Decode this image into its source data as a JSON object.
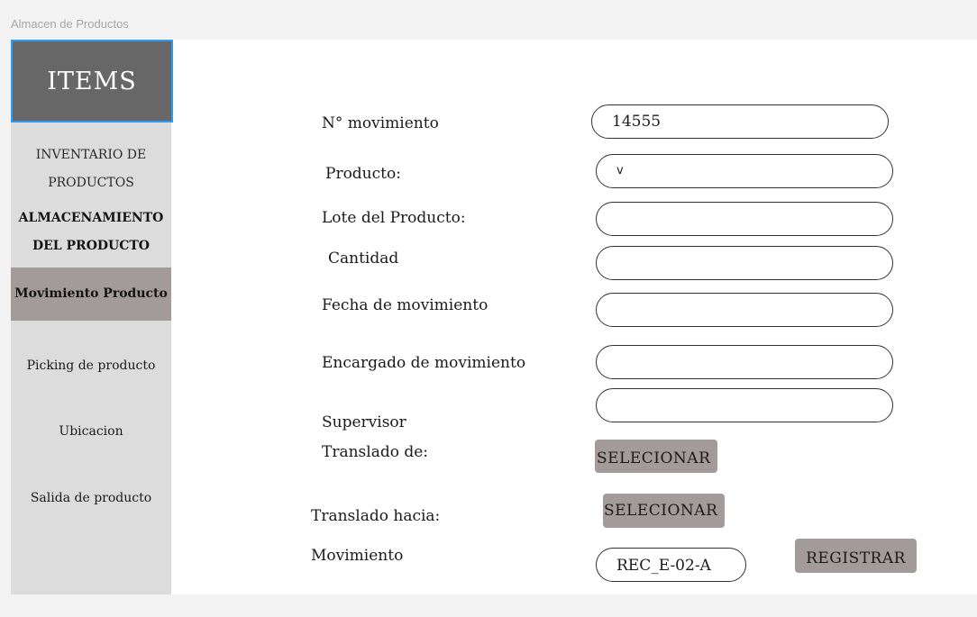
{
  "window": {
    "title": "Almacen de Productos"
  },
  "sidebar": {
    "header": "ITEMS",
    "items": [
      {
        "label_line1": "INVENTARIO DE",
        "label_line2": "PRODUCTOS"
      },
      {
        "label_line1": "ALMACENAMIENTO",
        "label_line2": "DEL PRODUCTO"
      },
      {
        "label": "Movimiento Producto",
        "active": true
      },
      {
        "label": "Picking de producto"
      },
      {
        "label": "Ubicacion"
      },
      {
        "label": "Salida de producto"
      }
    ]
  },
  "form": {
    "num_movimiento": {
      "label": "N° movimiento",
      "value": "14555"
    },
    "producto": {
      "label": "Producto:",
      "value": "v"
    },
    "lote": {
      "label": "Lote del Producto:",
      "value": ""
    },
    "cantidad": {
      "label": "Cantidad",
      "value": ""
    },
    "fecha": {
      "label": "Fecha de movimiento",
      "value": ""
    },
    "encargado": {
      "label": "Encargado de movimiento",
      "value": ""
    },
    "supervisor": {
      "label": "Supervisor",
      "value": ""
    },
    "translado_de": {
      "label": "Translado de:",
      "button": "SELECIONAR"
    },
    "translado_hacia": {
      "label": "Translado hacia:",
      "button": "SELECIONAR"
    },
    "movimiento": {
      "label": "Movimiento",
      "value": "REC_E-02-A"
    },
    "registrar_button": "REGISTRAR"
  },
  "colors": {
    "sidebar_bg": "#dcdcdc",
    "header_bg": "#676767",
    "active_bg": "#a39a9a",
    "selection_border": "#2f9bf0"
  }
}
